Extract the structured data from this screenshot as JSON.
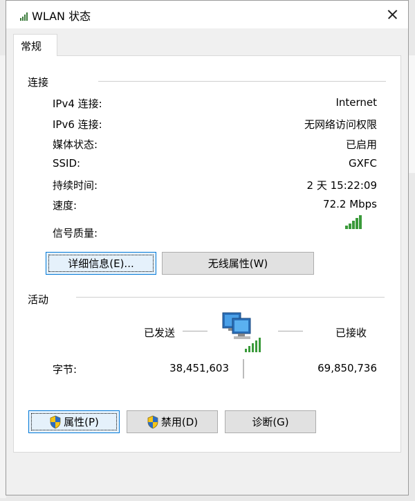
{
  "window": {
    "title": "WLAN 状态"
  },
  "tabs": [
    {
      "label": "常规"
    }
  ],
  "connection": {
    "heading": "连接",
    "rows": [
      {
        "label": "IPv4 连接:",
        "value": "Internet"
      },
      {
        "label": "IPv6 连接:",
        "value": "无网络访问权限"
      },
      {
        "label": "媒体状态:",
        "value": "已启用"
      },
      {
        "label": "SSID:",
        "value": "GXFC"
      },
      {
        "label": "持续时间:",
        "value": "2 天 15:22:09"
      },
      {
        "label": "速度:",
        "value": "72.2 Mbps"
      }
    ],
    "signal_label": "信号质量:",
    "signal_bars": 5,
    "details_button": "详细信息(E)...",
    "wireless_button": "无线属性(W)"
  },
  "activity": {
    "heading": "活动",
    "sent_label": "已发送",
    "received_label": "已接收",
    "bytes_label": "字节:",
    "bytes_sent": "38,451,603",
    "bytes_received": "69,850,736"
  },
  "footer": {
    "properties_button": "属性(P)",
    "disable_button": "禁用(D)",
    "diagnose_button": "诊断(G)"
  },
  "colors": {
    "accent": "#0078d7",
    "signal_green": "#3a9a3a",
    "panel": "#ffffff",
    "dialog": "#f0f0f0"
  },
  "icons": [
    "wifi-signal-icon",
    "close-icon",
    "signal-quality-icon",
    "network-computers-icon",
    "uac-shield-icon"
  ]
}
